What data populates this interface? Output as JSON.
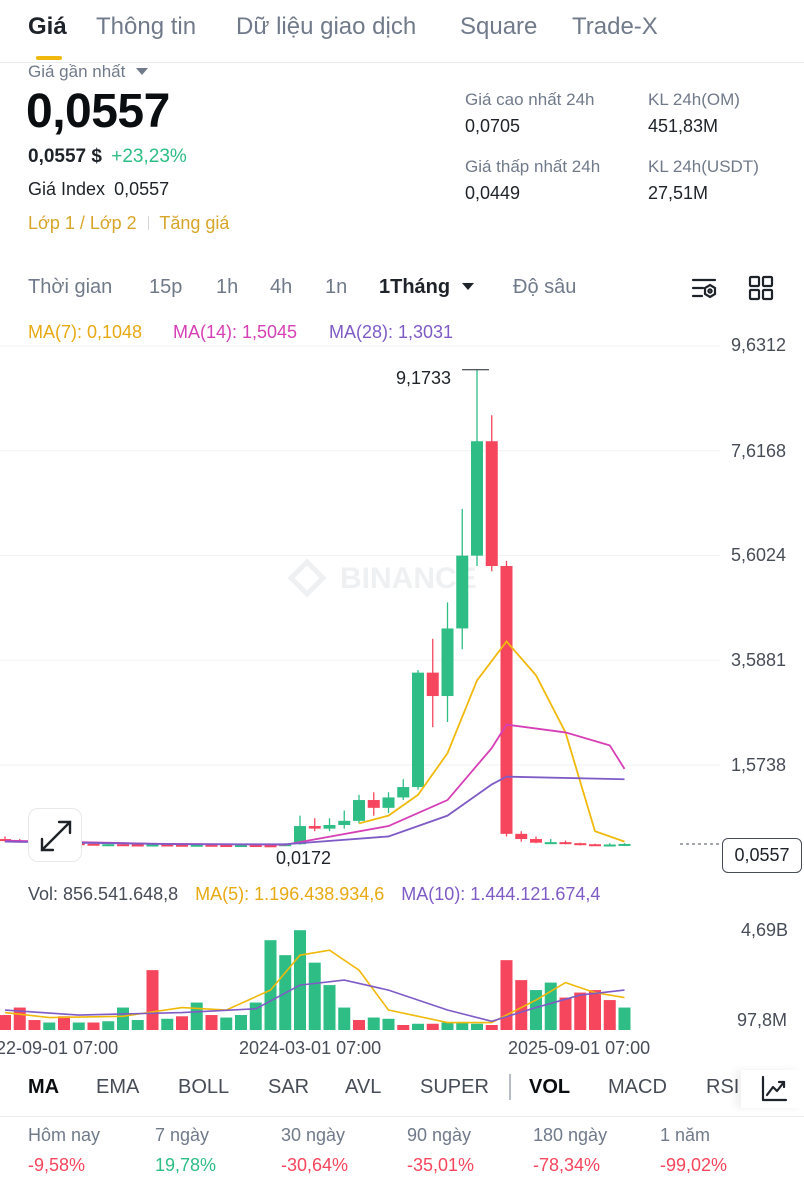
{
  "tabs": [
    "Giá",
    "Thông tin",
    "Dữ liệu giao dịch",
    "Square",
    "Trade-X"
  ],
  "summary": {
    "last_price_label": "Giá gần nhất",
    "last_price": "0,0557",
    "usd_price": "0,0557 $",
    "change_pct": "+23,23%",
    "index_label": "Giá Index",
    "index_value": "0,0557",
    "layer_link": "Lớp 1 / Lớp 2",
    "tag_link": "Tăng giá",
    "high_label": "Giá cao nhất 24h",
    "high_value": "0,0705",
    "low_label": "Giá thấp nhất 24h",
    "low_value": "0,0449",
    "vol_om_label": "KL 24h(OM)",
    "vol_om_value": "451,83M",
    "vol_usdt_label": "KL 24h(USDT)",
    "vol_usdt_value": "27,51M"
  },
  "intervals": [
    "Thời gian",
    "15p",
    "1h",
    "4h",
    "1n",
    "1Tháng",
    "Độ sâu"
  ],
  "ma_legend": {
    "ma7": "MA(7): 0,1048",
    "ma14": "MA(14): 1,5045",
    "ma28": "MA(28): 1,3031"
  },
  "price_axis": [
    "9,6312",
    "7,6168",
    "5,6024",
    "3,5881",
    "1,5738"
  ],
  "max_marker": "9,1733",
  "min_marker": "0,0172",
  "current_price_tag": "0,0557",
  "watermark": "BINANCE",
  "volume_legend": {
    "vol": "Vol: 856.541.648,8",
    "ma5": "MA(5): 1.196.438.934,6",
    "ma10": "MA(10): 1.444.121.674,4"
  },
  "volume_axis": [
    "4,69B",
    "97,8M"
  ],
  "time_axis": [
    "22-09-01 07:00",
    "2024-03-01 07:00",
    "2025-09-01 07:00"
  ],
  "indicators_main": [
    "MA",
    "EMA",
    "BOLL",
    "SAR",
    "AVL",
    "SUPER"
  ],
  "indicators_sub": [
    "VOL",
    "MACD",
    "RSI"
  ],
  "performance": [
    {
      "label": "Hôm nay",
      "value": "-9,58%"
    },
    {
      "label": "7 ngày",
      "value": "19,78%"
    },
    {
      "label": "30 ngày",
      "value": "-30,64%"
    },
    {
      "label": "90 ngày",
      "value": "-35,01%"
    },
    {
      "label": "180 ngày",
      "value": "-78,34%"
    },
    {
      "label": "1 năm",
      "value": "-99,02%"
    }
  ],
  "colors": {
    "up": "#2ebd85",
    "down": "#f6465d",
    "ma7": "#f0b90b",
    "ma14": "#d63fb5",
    "ma28": "#7f5bc6",
    "accent": "#f0b90b"
  },
  "chart_data": {
    "type": "candlestick",
    "price_axis_ticks": [
      9.6312,
      7.6168,
      5.6024,
      3.5881,
      1.5738
    ],
    "max_price": 9.1733,
    "min_price": 0.0172,
    "last_price": 0.0557,
    "candles": [
      {
        "o": 0.15,
        "c": 0.12,
        "h": 0.2,
        "l": 0.1
      },
      {
        "o": 0.12,
        "c": 0.1,
        "h": 0.15,
        "l": 0.08
      },
      {
        "o": 0.1,
        "c": 0.09,
        "h": 0.12,
        "l": 0.07
      },
      {
        "o": 0.09,
        "c": 0.08,
        "h": 0.11,
        "l": 0.06
      },
      {
        "o": 0.08,
        "c": 0.07,
        "h": 0.1,
        "l": 0.05
      },
      {
        "o": 0.07,
        "c": 0.06,
        "h": 0.09,
        "l": 0.04
      },
      {
        "o": 0.06,
        "c": 0.05,
        "h": 0.08,
        "l": 0.03
      },
      {
        "o": 0.05,
        "c": 0.05,
        "h": 0.07,
        "l": 0.03
      },
      {
        "o": 0.05,
        "c": 0.045,
        "h": 0.06,
        "l": 0.03
      },
      {
        "o": 0.045,
        "c": 0.04,
        "h": 0.06,
        "l": 0.03
      },
      {
        "o": 0.04,
        "c": 0.045,
        "h": 0.06,
        "l": 0.03
      },
      {
        "o": 0.045,
        "c": 0.04,
        "h": 0.06,
        "l": 0.03
      },
      {
        "o": 0.04,
        "c": 0.035,
        "h": 0.05,
        "l": 0.02
      },
      {
        "o": 0.035,
        "c": 0.04,
        "h": 0.05,
        "l": 0.02
      },
      {
        "o": 0.04,
        "c": 0.035,
        "h": 0.05,
        "l": 0.02
      },
      {
        "o": 0.035,
        "c": 0.03,
        "h": 0.045,
        "l": 0.02
      },
      {
        "o": 0.03,
        "c": 0.035,
        "h": 0.045,
        "l": 0.02
      },
      {
        "o": 0.035,
        "c": 0.03,
        "h": 0.045,
        "l": 0.02
      },
      {
        "o": 0.03,
        "c": 0.028,
        "h": 0.04,
        "l": 0.0172
      },
      {
        "o": 0.028,
        "c": 0.05,
        "h": 0.07,
        "l": 0.02
      },
      {
        "o": 0.05,
        "c": 0.4,
        "h": 0.6,
        "l": 0.04
      },
      {
        "o": 0.4,
        "c": 0.35,
        "h": 0.55,
        "l": 0.3
      },
      {
        "o": 0.35,
        "c": 0.42,
        "h": 0.55,
        "l": 0.3
      },
      {
        "o": 0.42,
        "c": 0.5,
        "h": 0.7,
        "l": 0.35
      },
      {
        "o": 0.5,
        "c": 0.9,
        "h": 1.0,
        "l": 0.45
      },
      {
        "o": 0.9,
        "c": 0.75,
        "h": 1.05,
        "l": 0.6
      },
      {
        "o": 0.75,
        "c": 0.95,
        "h": 1.05,
        "l": 0.65
      },
      {
        "o": 0.95,
        "c": 1.15,
        "h": 1.3,
        "l": 0.9
      },
      {
        "o": 1.15,
        "c": 3.35,
        "h": 3.4,
        "l": 1.1
      },
      {
        "o": 3.35,
        "c": 2.9,
        "h": 4.0,
        "l": 2.3
      },
      {
        "o": 2.9,
        "c": 4.2,
        "h": 4.7,
        "l": 2.4
      },
      {
        "o": 4.2,
        "c": 5.6,
        "h": 6.5,
        "l": 3.8
      },
      {
        "o": 5.6,
        "c": 7.8,
        "h": 9.1733,
        "l": 5.4
      },
      {
        "o": 7.8,
        "c": 5.4,
        "h": 8.3,
        "l": 5.3
      },
      {
        "o": 5.4,
        "c": 0.25,
        "h": 5.5,
        "l": 0.2
      },
      {
        "o": 0.25,
        "c": 0.15,
        "h": 0.3,
        "l": 0.1
      },
      {
        "o": 0.15,
        "c": 0.08,
        "h": 0.2,
        "l": 0.07
      },
      {
        "o": 0.08,
        "c": 0.09,
        "h": 0.15,
        "l": 0.06
      },
      {
        "o": 0.09,
        "c": 0.07,
        "h": 0.12,
        "l": 0.05
      },
      {
        "o": 0.07,
        "c": 0.05,
        "h": 0.08,
        "l": 0.03
      },
      {
        "o": 0.05,
        "c": 0.04,
        "h": 0.06,
        "l": 0.03
      },
      {
        "o": 0.04,
        "c": 0.045,
        "h": 0.07,
        "l": 0.03
      },
      {
        "o": 0.045,
        "c": 0.0557,
        "h": 0.0705,
        "l": 0.0449
      }
    ],
    "ma7": [
      {
        "i": 24,
        "v": 0.45
      },
      {
        "i": 26,
        "v": 0.6
      },
      {
        "i": 28,
        "v": 1.0
      },
      {
        "i": 30,
        "v": 1.8
      },
      {
        "i": 32,
        "v": 3.2
      },
      {
        "i": 34,
        "v": 3.95
      },
      {
        "i": 36,
        "v": 3.3
      },
      {
        "i": 38,
        "v": 2.2
      },
      {
        "i": 40,
        "v": 0.3
      },
      {
        "i": 42,
        "v": 0.1
      }
    ],
    "ma14": [
      {
        "i": 0,
        "v": 0.12
      },
      {
        "i": 10,
        "v": 0.06
      },
      {
        "i": 19,
        "v": 0.04
      },
      {
        "i": 26,
        "v": 0.4
      },
      {
        "i": 30,
        "v": 0.9
      },
      {
        "i": 33,
        "v": 1.9
      },
      {
        "i": 34,
        "v": 2.35
      },
      {
        "i": 38,
        "v": 2.2
      },
      {
        "i": 41,
        "v": 1.95
      },
      {
        "i": 42,
        "v": 1.5
      }
    ],
    "ma28": [
      {
        "i": 0,
        "v": 0.1
      },
      {
        "i": 12,
        "v": 0.05
      },
      {
        "i": 19,
        "v": 0.05
      },
      {
        "i": 26,
        "v": 0.2
      },
      {
        "i": 30,
        "v": 0.6
      },
      {
        "i": 33,
        "v": 1.2
      },
      {
        "i": 34,
        "v": 1.35
      },
      {
        "i": 42,
        "v": 1.3
      }
    ],
    "volumes": [
      {
        "v": 0.6,
        "up": false
      },
      {
        "v": 0.9,
        "up": false
      },
      {
        "v": 0.4,
        "up": false
      },
      {
        "v": 0.3,
        "up": true
      },
      {
        "v": 0.55,
        "up": false
      },
      {
        "v": 0.3,
        "up": true
      },
      {
        "v": 0.3,
        "up": false
      },
      {
        "v": 0.35,
        "up": true
      },
      {
        "v": 0.9,
        "up": true
      },
      {
        "v": 0.4,
        "up": true
      },
      {
        "v": 2.4,
        "up": false
      },
      {
        "v": 0.45,
        "up": true
      },
      {
        "v": 0.55,
        "up": false
      },
      {
        "v": 1.1,
        "up": true
      },
      {
        "v": 0.6,
        "up": false
      },
      {
        "v": 0.5,
        "up": true
      },
      {
        "v": 0.6,
        "up": true
      },
      {
        "v": 1.1,
        "up": true
      },
      {
        "v": 3.6,
        "up": true
      },
      {
        "v": 3.0,
        "up": true
      },
      {
        "v": 4.0,
        "up": true
      },
      {
        "v": 2.7,
        "up": true
      },
      {
        "v": 1.8,
        "up": true
      },
      {
        "v": 0.9,
        "up": true
      },
      {
        "v": 0.4,
        "up": false
      },
      {
        "v": 0.5,
        "up": true
      },
      {
        "v": 0.45,
        "up": true
      },
      {
        "v": 0.2,
        "up": false
      },
      {
        "v": 0.25,
        "up": true
      },
      {
        "v": 0.25,
        "up": false
      },
      {
        "v": 0.3,
        "up": true
      },
      {
        "v": 0.3,
        "up": true
      },
      {
        "v": 0.25,
        "up": true
      },
      {
        "v": 0.2,
        "up": false
      },
      {
        "v": 2.8,
        "up": false
      },
      {
        "v": 2.0,
        "up": false
      },
      {
        "v": 1.6,
        "up": true
      },
      {
        "v": 1.9,
        "up": true
      },
      {
        "v": 1.3,
        "up": false
      },
      {
        "v": 1.5,
        "up": false
      },
      {
        "v": 1.6,
        "up": false
      },
      {
        "v": 1.2,
        "up": false
      },
      {
        "v": 0.9,
        "up": true
      }
    ],
    "vol_ma5": [
      {
        "i": 0,
        "v": 0.7
      },
      {
        "i": 3,
        "v": 0.5
      },
      {
        "i": 8,
        "v": 0.55
      },
      {
        "i": 12,
        "v": 0.9
      },
      {
        "i": 15,
        "v": 0.8
      },
      {
        "i": 18,
        "v": 1.6
      },
      {
        "i": 20,
        "v": 3.0
      },
      {
        "i": 22,
        "v": 3.2
      },
      {
        "i": 24,
        "v": 2.4
      },
      {
        "i": 26,
        "v": 0.8
      },
      {
        "i": 30,
        "v": 0.3
      },
      {
        "i": 33,
        "v": 0.3
      },
      {
        "i": 36,
        "v": 1.2
      },
      {
        "i": 38,
        "v": 1.9
      },
      {
        "i": 40,
        "v": 1.5
      },
      {
        "i": 42,
        "v": 1.3
      }
    ],
    "vol_ma10": [
      {
        "i": 0,
        "v": 0.8
      },
      {
        "i": 5,
        "v": 0.6
      },
      {
        "i": 12,
        "v": 0.7
      },
      {
        "i": 17,
        "v": 0.85
      },
      {
        "i": 20,
        "v": 1.8
      },
      {
        "i": 23,
        "v": 2.0
      },
      {
        "i": 26,
        "v": 1.6
      },
      {
        "i": 30,
        "v": 0.8
      },
      {
        "i": 33,
        "v": 0.35
      },
      {
        "i": 36,
        "v": 0.9
      },
      {
        "i": 39,
        "v": 1.4
      },
      {
        "i": 42,
        "v": 1.6
      }
    ]
  }
}
